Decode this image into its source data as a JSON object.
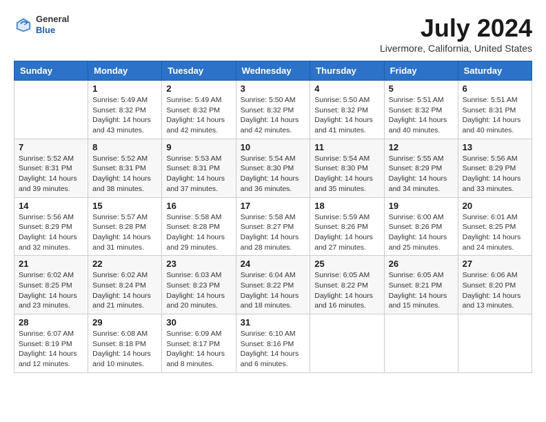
{
  "header": {
    "logo": {
      "general": "General",
      "blue": "Blue"
    },
    "title": "July 2024",
    "location": "Livermore, California, United States"
  },
  "days_of_week": [
    "Sunday",
    "Monday",
    "Tuesday",
    "Wednesday",
    "Thursday",
    "Friday",
    "Saturday"
  ],
  "weeks": [
    [
      {
        "day": "",
        "info": ""
      },
      {
        "day": "1",
        "info": "Sunrise: 5:49 AM\nSunset: 8:32 PM\nDaylight: 14 hours\nand 43 minutes."
      },
      {
        "day": "2",
        "info": "Sunrise: 5:49 AM\nSunset: 8:32 PM\nDaylight: 14 hours\nand 42 minutes."
      },
      {
        "day": "3",
        "info": "Sunrise: 5:50 AM\nSunset: 8:32 PM\nDaylight: 14 hours\nand 42 minutes."
      },
      {
        "day": "4",
        "info": "Sunrise: 5:50 AM\nSunset: 8:32 PM\nDaylight: 14 hours\nand 41 minutes."
      },
      {
        "day": "5",
        "info": "Sunrise: 5:51 AM\nSunset: 8:32 PM\nDaylight: 14 hours\nand 40 minutes."
      },
      {
        "day": "6",
        "info": "Sunrise: 5:51 AM\nSunset: 8:31 PM\nDaylight: 14 hours\nand 40 minutes."
      }
    ],
    [
      {
        "day": "7",
        "info": "Sunrise: 5:52 AM\nSunset: 8:31 PM\nDaylight: 14 hours\nand 39 minutes."
      },
      {
        "day": "8",
        "info": "Sunrise: 5:52 AM\nSunset: 8:31 PM\nDaylight: 14 hours\nand 38 minutes."
      },
      {
        "day": "9",
        "info": "Sunrise: 5:53 AM\nSunset: 8:31 PM\nDaylight: 14 hours\nand 37 minutes."
      },
      {
        "day": "10",
        "info": "Sunrise: 5:54 AM\nSunset: 8:30 PM\nDaylight: 14 hours\nand 36 minutes."
      },
      {
        "day": "11",
        "info": "Sunrise: 5:54 AM\nSunset: 8:30 PM\nDaylight: 14 hours\nand 35 minutes."
      },
      {
        "day": "12",
        "info": "Sunrise: 5:55 AM\nSunset: 8:29 PM\nDaylight: 14 hours\nand 34 minutes."
      },
      {
        "day": "13",
        "info": "Sunrise: 5:56 AM\nSunset: 8:29 PM\nDaylight: 14 hours\nand 33 minutes."
      }
    ],
    [
      {
        "day": "14",
        "info": "Sunrise: 5:56 AM\nSunset: 8:29 PM\nDaylight: 14 hours\nand 32 minutes."
      },
      {
        "day": "15",
        "info": "Sunrise: 5:57 AM\nSunset: 8:28 PM\nDaylight: 14 hours\nand 31 minutes."
      },
      {
        "day": "16",
        "info": "Sunrise: 5:58 AM\nSunset: 8:28 PM\nDaylight: 14 hours\nand 29 minutes."
      },
      {
        "day": "17",
        "info": "Sunrise: 5:58 AM\nSunset: 8:27 PM\nDaylight: 14 hours\nand 28 minutes."
      },
      {
        "day": "18",
        "info": "Sunrise: 5:59 AM\nSunset: 8:26 PM\nDaylight: 14 hours\nand 27 minutes."
      },
      {
        "day": "19",
        "info": "Sunrise: 6:00 AM\nSunset: 8:26 PM\nDaylight: 14 hours\nand 25 minutes."
      },
      {
        "day": "20",
        "info": "Sunrise: 6:01 AM\nSunset: 8:25 PM\nDaylight: 14 hours\nand 24 minutes."
      }
    ],
    [
      {
        "day": "21",
        "info": "Sunrise: 6:02 AM\nSunset: 8:25 PM\nDaylight: 14 hours\nand 23 minutes."
      },
      {
        "day": "22",
        "info": "Sunrise: 6:02 AM\nSunset: 8:24 PM\nDaylight: 14 hours\nand 21 minutes."
      },
      {
        "day": "23",
        "info": "Sunrise: 6:03 AM\nSunset: 8:23 PM\nDaylight: 14 hours\nand 20 minutes."
      },
      {
        "day": "24",
        "info": "Sunrise: 6:04 AM\nSunset: 8:22 PM\nDaylight: 14 hours\nand 18 minutes."
      },
      {
        "day": "25",
        "info": "Sunrise: 6:05 AM\nSunset: 8:22 PM\nDaylight: 14 hours\nand 16 minutes."
      },
      {
        "day": "26",
        "info": "Sunrise: 6:05 AM\nSunset: 8:21 PM\nDaylight: 14 hours\nand 15 minutes."
      },
      {
        "day": "27",
        "info": "Sunrise: 6:06 AM\nSunset: 8:20 PM\nDaylight: 14 hours\nand 13 minutes."
      }
    ],
    [
      {
        "day": "28",
        "info": "Sunrise: 6:07 AM\nSunset: 8:19 PM\nDaylight: 14 hours\nand 12 minutes."
      },
      {
        "day": "29",
        "info": "Sunrise: 6:08 AM\nSunset: 8:18 PM\nDaylight: 14 hours\nand 10 minutes."
      },
      {
        "day": "30",
        "info": "Sunrise: 6:09 AM\nSunset: 8:17 PM\nDaylight: 14 hours\nand 8 minutes."
      },
      {
        "day": "31",
        "info": "Sunrise: 6:10 AM\nSunset: 8:16 PM\nDaylight: 14 hours\nand 6 minutes."
      },
      {
        "day": "",
        "info": ""
      },
      {
        "day": "",
        "info": ""
      },
      {
        "day": "",
        "info": ""
      }
    ]
  ]
}
